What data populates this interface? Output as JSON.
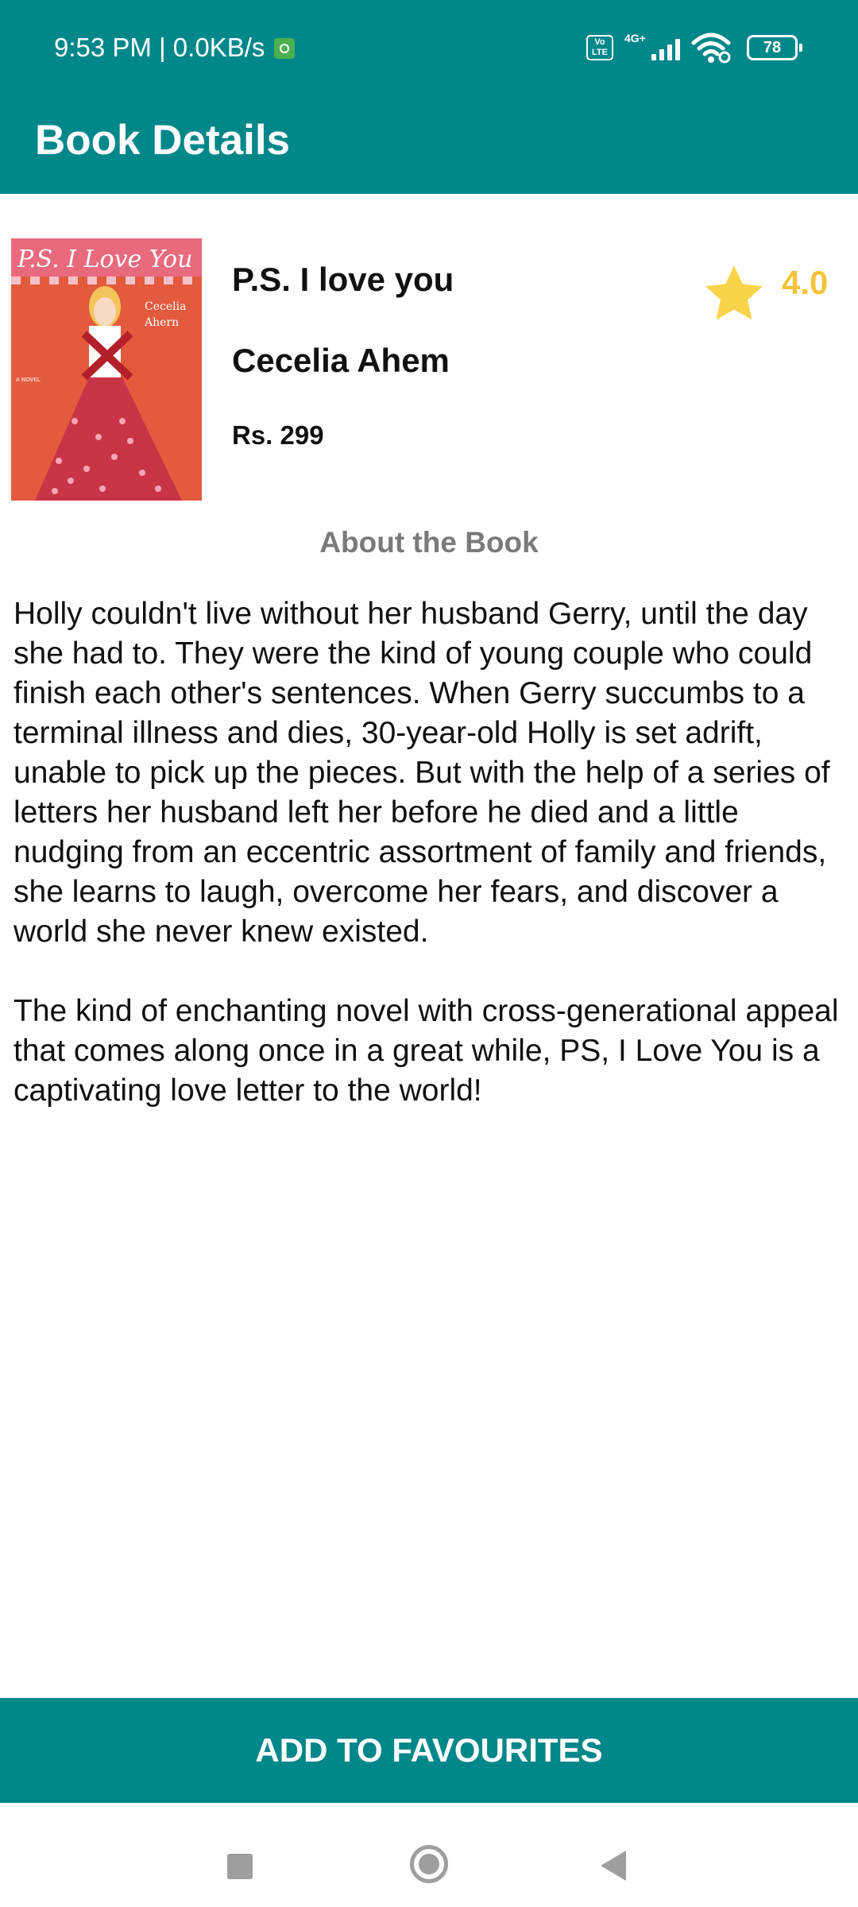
{
  "status_bar": {
    "time_speed": "9:53 PM | 0.0KB/s",
    "volte": "Vo LTE",
    "network": "4G+",
    "battery": "78"
  },
  "app_bar": {
    "title": "Book Details"
  },
  "book": {
    "cover_icon": "book-cover-image",
    "cover_text": {
      "title": "P.S. I Love You",
      "author": "Cecelia Ahern",
      "label": "A NOVEL"
    },
    "title": "P.S. I love you",
    "author": "Cecelia Ahem",
    "price": "Rs. 299",
    "rating": "4.0",
    "rating_icon": "star-icon"
  },
  "about": {
    "heading": "About the Book",
    "description": "Holly couldn't live without her husband Gerry, until the day she had to. They were the kind of young couple who could finish each other's sentences. When Gerry succumbs to a terminal illness and dies, 30-year-old Holly is set adrift, unable to pick up the pieces. But with the help of a series of letters her husband left her before he died and a little nudging from an eccentric assortment of family and friends, she learns to laugh, overcome her fears, and discover a world she never knew existed.\n\nThe kind of enchanting novel with cross-generational appeal that comes along once in a great while, PS, I Love You is a captivating love letter to the world!"
  },
  "actions": {
    "add_to_favourites": "ADD TO FAVOURITES"
  },
  "navigation": {
    "recents_icon": "square-icon",
    "home_icon": "circle-icon",
    "back_icon": "triangle-back-icon"
  },
  "colors": {
    "primary": "#00878A",
    "rating": "#F6C43A",
    "heading_gray": "#7a7a7a"
  }
}
